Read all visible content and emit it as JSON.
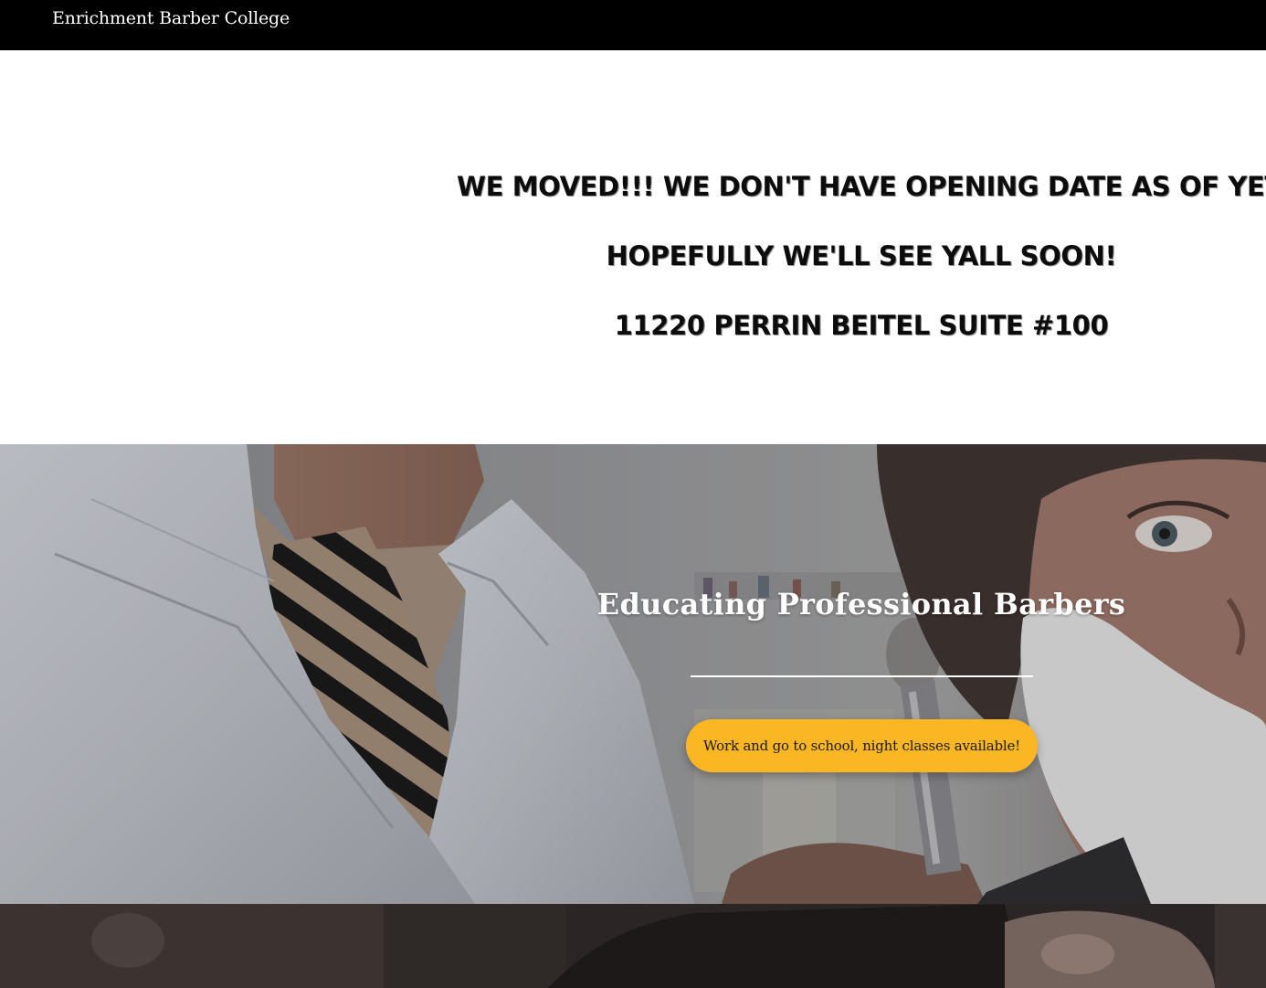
{
  "header": {
    "brand": "Enrichment Barber College"
  },
  "announcement": {
    "lines": [
      "WE MOVED!!! WE DON'T HAVE OPENING DATE AS OF YET!",
      "HOPEFULLY WE'LL SEE YALL SOON!",
      "11220 PERRIN BEITEL SUITE #100"
    ]
  },
  "hero": {
    "title": "Educating Professional Barbers",
    "cta_label": "Work and go to school, night classes available!"
  },
  "colors": {
    "topbar": "#000000",
    "accent": "#fbb624",
    "heading_text": "#0c0c0c",
    "hero_text": "#ffffff"
  }
}
